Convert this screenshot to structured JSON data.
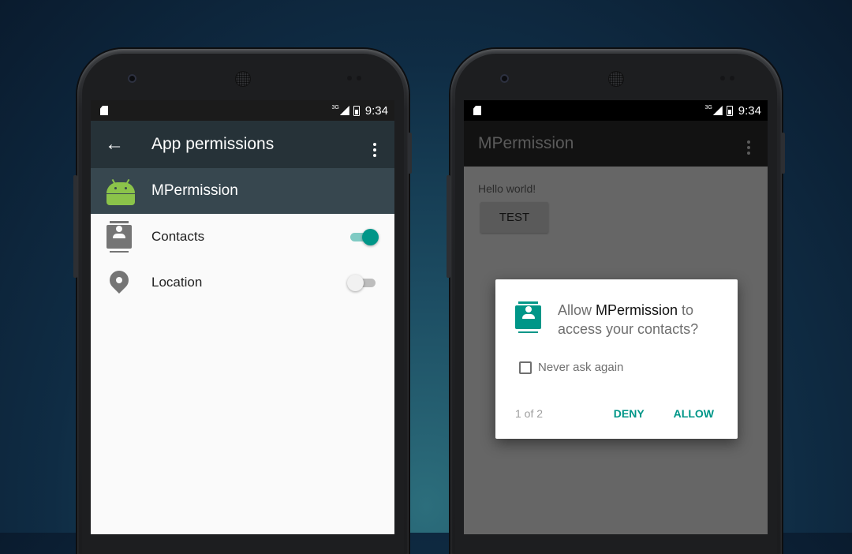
{
  "left_phone": {
    "status_bar": {
      "network": "3G",
      "time": "9:34"
    },
    "app_bar": {
      "title": "App permissions",
      "back_icon": "arrow-back-icon",
      "menu_icon": "more-vert-icon"
    },
    "app_header": {
      "app_name": "MPermission",
      "icon": "android-robot-icon"
    },
    "permissions": [
      {
        "label": "Contacts",
        "icon": "contacts-icon",
        "enabled": true
      },
      {
        "label": "Location",
        "icon": "location-pin-icon",
        "enabled": false
      }
    ]
  },
  "right_phone": {
    "status_bar": {
      "network": "3G",
      "time": "9:34"
    },
    "app_bar": {
      "title": "MPermission",
      "menu_icon": "more-vert-icon"
    },
    "content": {
      "hello_text": "Hello world!",
      "test_button": "TEST"
    },
    "dialog": {
      "message_prefix": "Allow ",
      "app_name": "MPermission",
      "message_line1_suffix": " to",
      "message_line2": "access your contacts?",
      "checkbox_label": "Never ask again",
      "counter": "1 of 2",
      "deny_button": "DENY",
      "allow_button": "ALLOW",
      "icon": "contacts-icon"
    }
  },
  "colors": {
    "accent": "#009688",
    "toolbar": "#263238",
    "app_header": "#37474f",
    "android_green": "#8bc34a"
  }
}
